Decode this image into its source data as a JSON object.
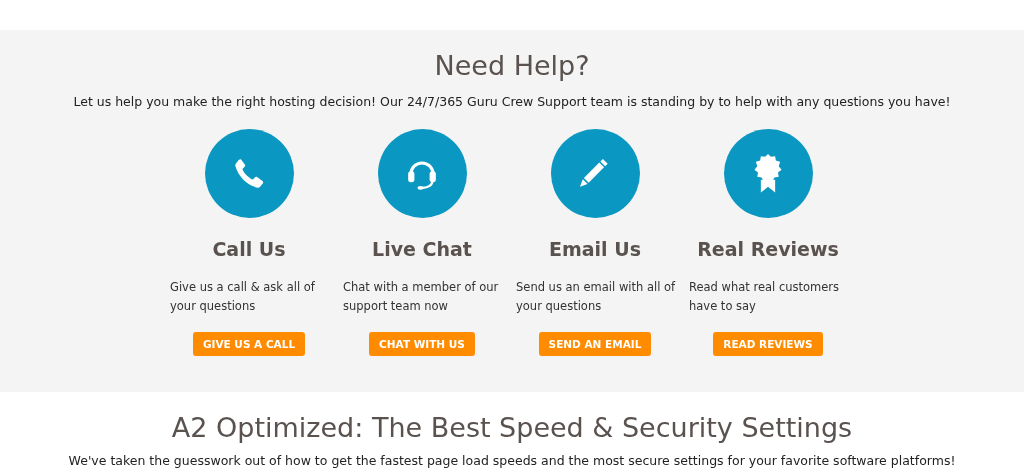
{
  "help": {
    "title": "Need Help?",
    "intro": "Let us help you make the right hosting decision! Our 24/7/365 Guru Crew Support team is standing by to help with any questions you have!",
    "options": [
      {
        "kind": "phone",
        "heading": "Call Us",
        "description": "Give us a call & ask all of your questions",
        "button": "GIVE US A CALL"
      },
      {
        "kind": "headset",
        "heading": "Live Chat",
        "description": "Chat with a member of our support team now",
        "button": "CHAT WITH US"
      },
      {
        "kind": "pencil",
        "heading": "Email Us",
        "description": "Send us an email with all of your questions",
        "button": "SEND AN EMAIL"
      },
      {
        "kind": "award",
        "heading": "Real Reviews",
        "description": "Read what real customers have to say",
        "button": "READ REVIEWS"
      }
    ]
  },
  "optimized": {
    "title": "A2 Optimized: The Best Speed & Security Settings",
    "intro": "We've taken the guesswork out of how to get the fastest page load speeds and the most secure settings for your favorite software platforms!"
  }
}
